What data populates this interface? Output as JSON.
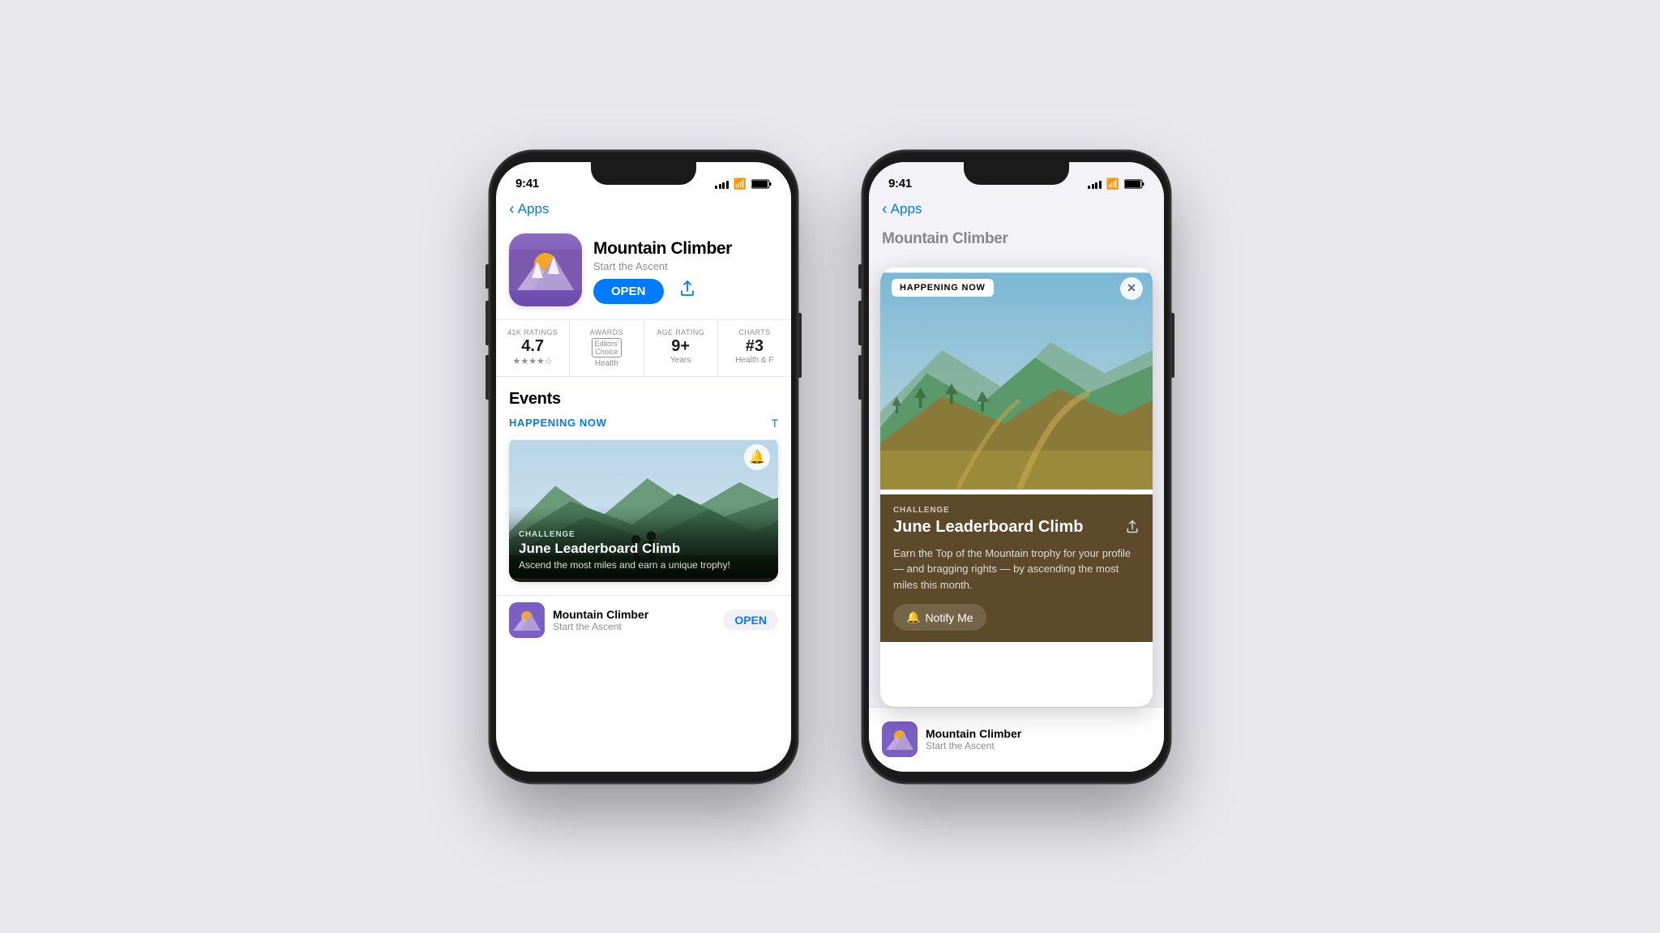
{
  "page": {
    "background": "#e8e8ed"
  },
  "phone1": {
    "status": {
      "time": "9:41",
      "signal": [
        3,
        4,
        5,
        6,
        7
      ],
      "wifi": "wifi",
      "battery": "battery"
    },
    "nav": {
      "back_label": "Apps"
    },
    "app": {
      "name": "Mountain Climber",
      "subtitle": "Start the Ascent",
      "open_button": "OPEN",
      "ratings_count": "41K RATINGS",
      "rating_value": "4.7",
      "awards_label": "AWARDS",
      "awards_value": "Editors'\nChoice",
      "awards_sub": "Health",
      "age_label": "AGE RATING",
      "age_value": "9+",
      "age_sub": "Years",
      "chart_label": "CHARTS",
      "chart_value": "#3",
      "chart_sub": "Health & F"
    },
    "events": {
      "section_title": "Events",
      "happening_now": "HAPPENING NOW",
      "see_all": "T",
      "event_type": "CHALLENGE",
      "event_title": "June Leaderboard Climb",
      "event_desc": "Ascend the most miles and earn a unique trophy!"
    },
    "bottom_app": {
      "name": "Mountain Climber",
      "subtitle": "Start the Ascent",
      "open_button": "OPEN"
    }
  },
  "phone2": {
    "status": {
      "time": "9:41"
    },
    "nav": {
      "back_label": "Apps"
    },
    "overlay": {
      "badge": "HAPPENING NOW",
      "close": "✕",
      "event_type": "CHALLENGE",
      "event_title": "June Leaderboard Climb",
      "event_desc": "Earn the Top of the Mountain trophy for your profile — and bragging rights — by ascending the most miles this month.",
      "notify_button": "Notify Me"
    },
    "bottom_app": {
      "name": "Mountain Climber",
      "subtitle": "Start the Ascent"
    }
  }
}
